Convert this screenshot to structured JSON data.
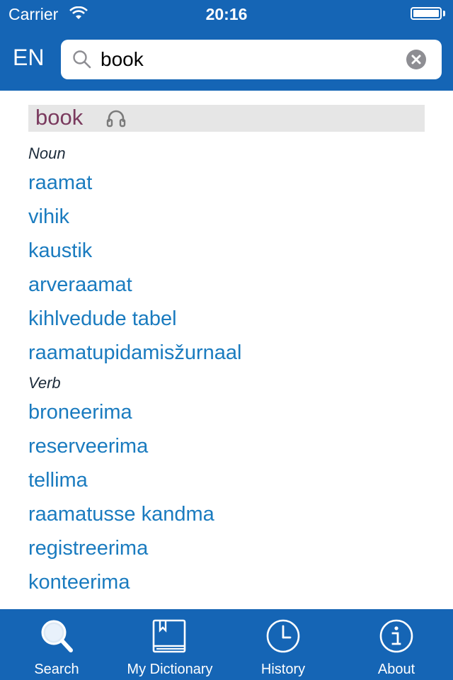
{
  "status_bar": {
    "carrier": "Carrier",
    "time": "20:16"
  },
  "header": {
    "language": "EN",
    "search": {
      "value": "book",
      "placeholder": ""
    }
  },
  "entry": {
    "headword": "book",
    "sections": [
      {
        "pos": "Noun",
        "translations": [
          "raamat",
          "vihik",
          "kaustik",
          "arveraamat",
          "kihlvedude tabel",
          "raamatupidamisžurnaal"
        ]
      },
      {
        "pos": "Verb",
        "translations": [
          "broneerima",
          "reserveerima",
          "tellima",
          "raamatusse kandma",
          "registreerima",
          "konteerima"
        ]
      }
    ]
  },
  "tabs": [
    {
      "label": "Search",
      "icon": "magnifier-icon"
    },
    {
      "label": "My Dictionary",
      "icon": "book-icon"
    },
    {
      "label": "History",
      "icon": "clock-icon"
    },
    {
      "label": "About",
      "icon": "info-icon"
    }
  ],
  "colors": {
    "bar_blue": "#1565b5",
    "headword": "#7a3a5e",
    "translation": "#1a7bbf",
    "part_of_speech": "#1c2b3a",
    "headword_bg": "#e6e6e6"
  }
}
